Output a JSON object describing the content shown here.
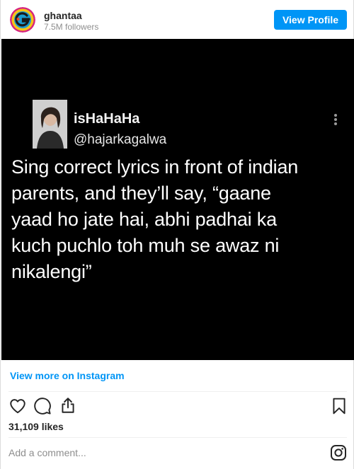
{
  "header": {
    "username": "ghantaa",
    "followers": "7.5M followers",
    "view_profile_label": "View Profile",
    "avatar_icon": "ghantaa-logo-icon"
  },
  "post": {
    "tweet": {
      "display_name": "isHaHaHa",
      "handle": "@hajarkagalwa",
      "text": "Sing correct lyrics in front of indian\nparents, and they’ll say, “gaane\nyaad ho jate hai, abhi padhai ka\nkuch puchlo toh muh se awaz ni\nnikalengi”"
    }
  },
  "view_more_label": "View more on Instagram",
  "actions": {
    "like_icon": "heart-icon",
    "comment_icon": "comment-icon",
    "share_icon": "share-icon",
    "save_icon": "bookmark-icon"
  },
  "likes": "31,109 likes",
  "comment": {
    "placeholder": "Add a comment..."
  },
  "colors": {
    "accent": "#0095f6",
    "text": "#262626",
    "muted": "#8e8e8e",
    "image_bg": "#000000"
  }
}
